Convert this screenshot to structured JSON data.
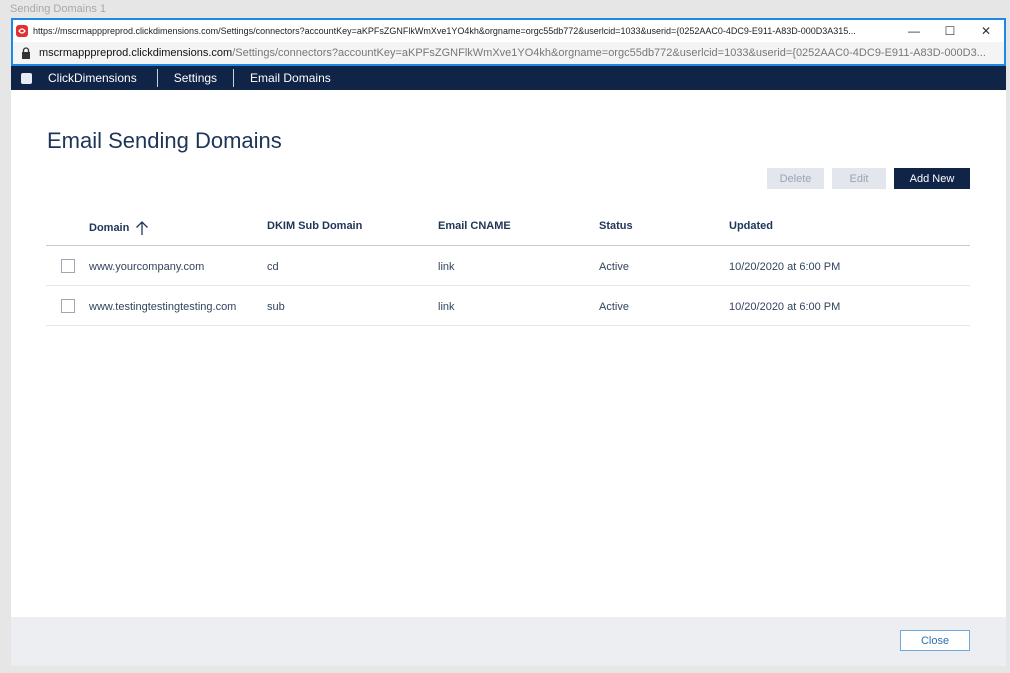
{
  "dialog": {
    "title": "Sending Domains 1"
  },
  "browser": {
    "title_url": "https://mscrmapppreprod.clickdimensions.com/Settings/connectors?accountKey=aKPFsZGNFlkWmXve1YO4kh&orgname=orgc55db772&userlcid=1033&userid={0252AAC0-4DC9-E911-A83D-000D3A315...",
    "address_host": "mscrmapppreprod.clickdimensions.com",
    "address_path": "/Settings/connectors?accountKey=aKPFsZGNFlkWmXve1YO4kh&orgname=orgc55db772&userlcid=1033&userid={0252AAC0-4DC9-E911-A83D-000D3...",
    "minimize": "—",
    "maximize": "☐",
    "close": "✕"
  },
  "nav": {
    "items": [
      "ClickDimensions",
      "Settings",
      "Email Domains"
    ]
  },
  "page": {
    "heading": "Email Sending Domains"
  },
  "actions": {
    "delete": "Delete",
    "edit": "Edit",
    "add_new": "Add New"
  },
  "table": {
    "columns": [
      "Domain",
      "DKIM Sub Domain",
      "Email CNAME",
      "Status",
      "Updated"
    ],
    "rows": [
      {
        "domain": "www.yourcompany.com",
        "dkim": "cd",
        "cname": "link",
        "status": "Active",
        "updated": "10/20/2020 at 6:00 PM"
      },
      {
        "domain": "www.testingtestingtesting.com",
        "dkim": "sub",
        "cname": "link",
        "status": "Active",
        "updated": "10/20/2020 at 6:00 PM"
      }
    ]
  },
  "footer": {
    "close": "Close"
  },
  "colors": {
    "nav_bg": "#0f2447",
    "frame_border": "#1e88e5",
    "favicon": "#e03131"
  }
}
